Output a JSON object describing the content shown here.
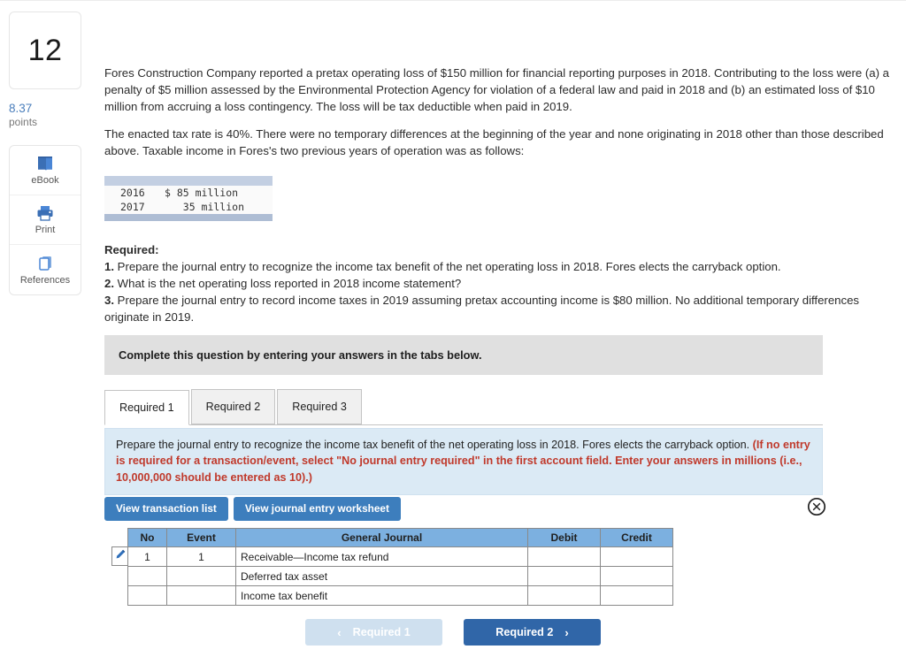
{
  "question": {
    "number": "12",
    "points_value": "8.37",
    "points_label": "points"
  },
  "tools": [
    {
      "label": "eBook",
      "icon": "book-icon"
    },
    {
      "label": "Print",
      "icon": "printer-icon"
    },
    {
      "label": "References",
      "icon": "references-icon"
    }
  ],
  "body": {
    "paragraph_1": "Fores Construction Company reported a pretax operating loss of $150 million for financial reporting purposes in 2018. Contributing to the loss were (a) a penalty of $5 million assessed by the Environmental Protection Agency for violation of a federal law and paid in 2018 and (b) an estimated loss of $10 million from accruing a loss contingency. The loss will be tax deductible when paid in 2019.",
    "paragraph_2": "The enacted tax rate is 40%. There were no temporary differences at the beginning of the year and none originating in 2018 other than those described above. Taxable income in Fores's two previous years of operation was as follows:"
  },
  "tax_table": {
    "rows": [
      {
        "year": "2016",
        "amount": "$ 85 million"
      },
      {
        "year": "2017",
        "amount": "   35 million"
      }
    ]
  },
  "required": {
    "heading": "Required:",
    "items": [
      {
        "num": "1.",
        "text": " Prepare the journal entry to recognize the income tax benefit of the net operating loss in 2018. Fores elects the carryback option."
      },
      {
        "num": "2.",
        "text": " What is the net operating loss reported in 2018 income statement?"
      },
      {
        "num": "3.",
        "text": " Prepare the journal entry to record income taxes in 2019 assuming pretax accounting income is $80 million. No additional temporary differences originate in 2019."
      }
    ]
  },
  "complete_banner": "Complete this question by entering your answers in the tabs below.",
  "tabs": [
    {
      "label": "Required 1",
      "active": true
    },
    {
      "label": "Required 2",
      "active": false
    },
    {
      "label": "Required 3",
      "active": false
    }
  ],
  "instruction": {
    "main": "Prepare the journal entry to recognize the income tax benefit of the net operating loss in 2018. Fores elects the carryback option. ",
    "hint": "(If no entry is required for a transaction/event, select \"No journal entry required\" in the first account field. Enter your answers in millions (i.e., 10,000,000 should be entered as 10).)"
  },
  "actions": {
    "transaction_list": "View transaction list",
    "journal_worksheet": "View journal entry worksheet",
    "close_icon": "close-circle-icon"
  },
  "journal": {
    "columns": [
      "No",
      "Event",
      "General Journal",
      "Debit",
      "Credit"
    ],
    "rows": [
      {
        "no": "1",
        "event": "1",
        "account": "Receivable—Income tax refund",
        "debit": "",
        "credit": "",
        "edit": true
      },
      {
        "no": "",
        "event": "",
        "account": "Deferred tax asset",
        "debit": "",
        "credit": "",
        "edit": false
      },
      {
        "no": "",
        "event": "",
        "account": "Income tax benefit",
        "debit": "",
        "credit": "",
        "edit": false
      }
    ]
  },
  "nav": {
    "prev_label": "Required 1",
    "next_label": "Required 2",
    "prev_chevron": "‹",
    "next_chevron": "›"
  },
  "colors": {
    "accent_blue": "#3d7ebd",
    "table_header_blue": "#7cb0e0",
    "instruction_bg": "#dbeaf5",
    "hint_red": "#c0392b",
    "banner_gray": "#e0e0e0",
    "next_button_blue": "#3066a8",
    "prev_button_blue": "#cfe0ef"
  }
}
